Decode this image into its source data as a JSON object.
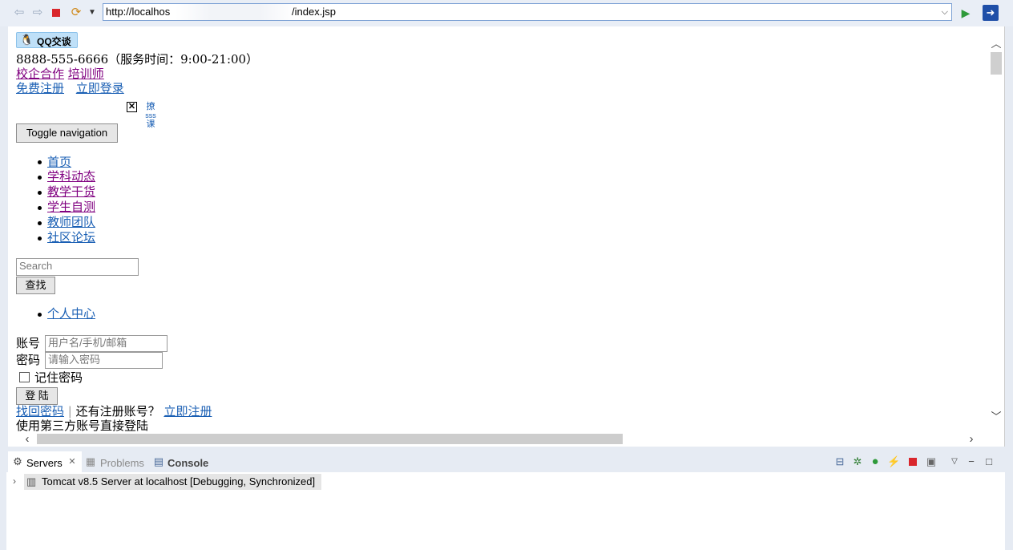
{
  "browser": {
    "url_prefix": "http://localhos",
    "url_suffix": "/index.jsp",
    "icons": [
      "back-icon",
      "forward-icon",
      "stop-icon",
      "refresh-icon",
      "dropdown-icon",
      "go-icon",
      "open-external-icon"
    ]
  },
  "page": {
    "qq_label": "QQ交谈",
    "phone": "8888-555-6666（服务时间：9:00-21:00）",
    "links_row1": [
      "校企合作",
      "培训师"
    ],
    "links_row2": [
      "免费注册",
      "立即登录"
    ],
    "broken_img_alt": "撩sss课",
    "alt_lines": [
      "撩",
      "sss",
      "课"
    ],
    "toggle_nav": "Toggle navigation",
    "nav_items": [
      "首页",
      "学科动态",
      "教学干货",
      "学生自测",
      "教师团队",
      "社区论坛"
    ],
    "search_placeholder": "Search",
    "search_button": "查找",
    "personal_center": "个人中心",
    "account_label": "账号",
    "account_placeholder": "用户名/手机/邮箱",
    "password_label": "密码",
    "password_placeholder": "请输入密码",
    "remember_label": "记住密码",
    "login_button": "登 陆",
    "retrieve_password": "找回密码",
    "separator": "|",
    "no_account_text": "还有注册账号？",
    "register_now": "立即注册",
    "third_party": "使用第三方账号直接登陆"
  },
  "panel": {
    "tabs": [
      {
        "label": "Servers",
        "active": true
      },
      {
        "label": "Problems",
        "active": false
      },
      {
        "label": "Console",
        "active": false
      }
    ],
    "server_entry": "Tomcat v8.5 Server at localhost  [Debugging, Synchronized]"
  },
  "colors": {
    "link": "#1a5fb4",
    "visited_link": "#800080",
    "url_border": "#7aa0d4"
  }
}
